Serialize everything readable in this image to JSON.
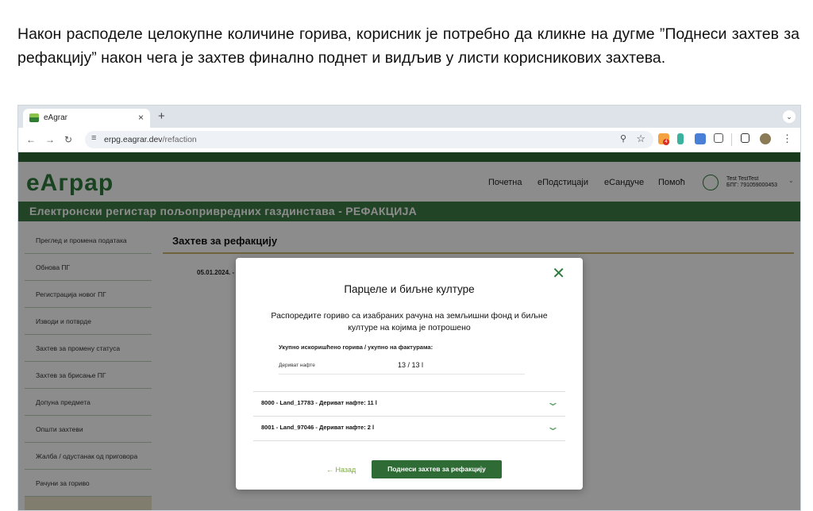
{
  "instruction": "Након расподеле целокупне количине горива, корисник је потребно да кликне на дугме ”Поднеси захтев за рефакцију” након чега је захтев финално поднет и видљив у листи корисникових захтева.",
  "browser": {
    "tab_title": "eAgrar",
    "tab_close": "×",
    "new_tab": "+",
    "tab_menu": "⌄",
    "url_host": "erpg.eagrar.dev",
    "url_path": "/refaction",
    "extension_badge": "4"
  },
  "site": {
    "logo": "еАграр",
    "nav": [
      "Почетна",
      "еПодстицаји",
      "еСандуче",
      "Помоћ"
    ],
    "user_name": "Test TestTest",
    "user_bpg": "БПГ: 791059000453",
    "banner": "Електронски регистар пољопривредних газдинстава - РЕФАКЦИЈА",
    "sidebar": [
      "Преглед и промена података",
      "Обнова ПГ",
      "Регистрација новог ПГ",
      "Изводи и потврде",
      "Захтев за промену статуса",
      "Захтев за брисање ПГ",
      "Допуна предмета",
      "Општи захтеви",
      "Жалба / одустанак од приговора",
      "Рачуни за гориво",
      ""
    ],
    "page_title": "Захтев за рефакцију",
    "date_cell": "05.01.2024. -"
  },
  "modal": {
    "close": "✕",
    "title": "Парцеле и биљне културе",
    "description": "Распоредите гориво са изабраних рачуна на земљишни фонд и биљне културе на којима је потрошено",
    "total_label": "Укупно искоришћено горива / укупно на фактурама:",
    "row_label": "Дериват нафте",
    "row_value": "13 / 13 l",
    "accordions": [
      "8000 - Land_17783 - Дериват нафте: 11 l",
      "8001 - Land_97046 - Дериват нафте: 2 l"
    ],
    "back": "← Назад",
    "submit": "Поднеси захтев за рефакцију"
  }
}
